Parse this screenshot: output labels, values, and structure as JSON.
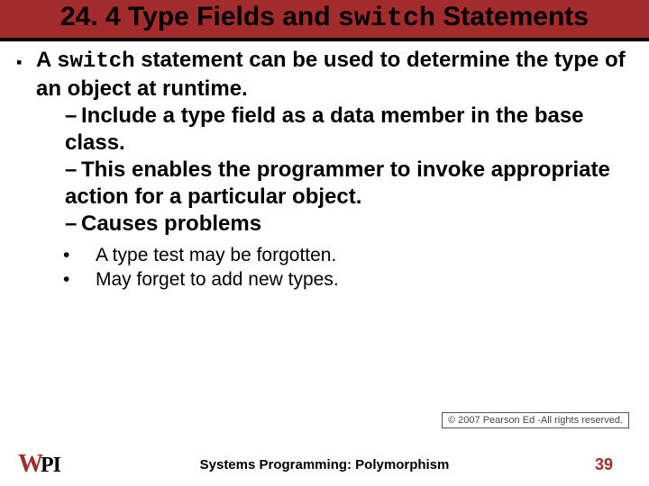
{
  "title": {
    "pre": "24. 4 Type Fields and ",
    "mono": "switch",
    "post": " Statements"
  },
  "bullet": {
    "pre": "A ",
    "mono": "switch",
    "post": " statement can be used to determine the type of an object at runtime."
  },
  "sub": [
    "Include a type field as a data member in the base class.",
    "This enables the programmer to invoke appropriate action for a particular object.",
    "Causes problems"
  ],
  "subsub": [
    "A type test may be forgotten.",
    "May forget to add new types."
  ],
  "copyright": "© 2007 Pearson Ed -All rights reserved.",
  "footer": "Systems Programming: Polymorphism",
  "page": "39",
  "logo": {
    "w": "W",
    "pi": "PI"
  }
}
